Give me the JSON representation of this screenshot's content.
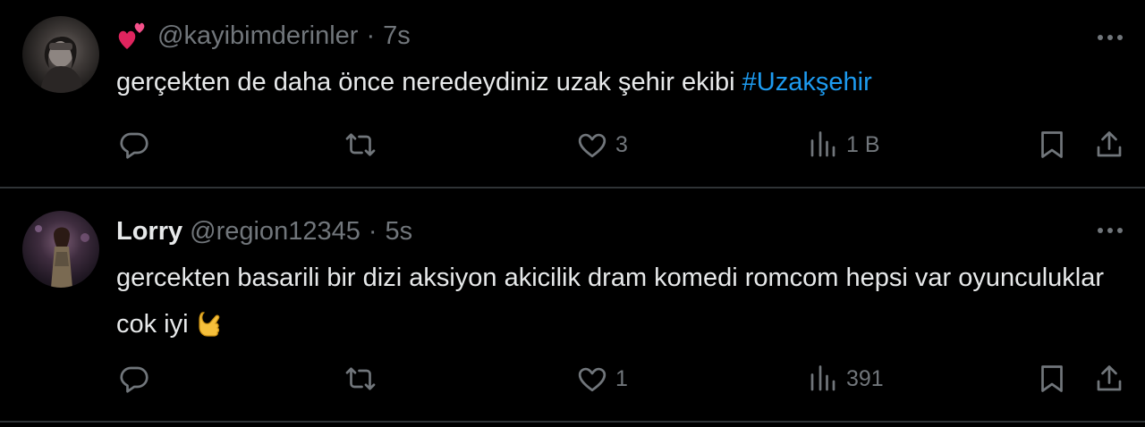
{
  "tweets": [
    {
      "display_name": "",
      "badge_icon": "two-hearts-icon",
      "handle": "@kayibimderinler",
      "separator": "·",
      "time": "7s",
      "text": "gerçekten de daha önce neredeydiniz uzak şehir ekibi ",
      "hashtag": "#Uzakşehir",
      "likes": "3",
      "views": "1 B"
    },
    {
      "display_name": "Lorry",
      "handle": "@region12345",
      "separator": "·",
      "time": "5s",
      "text": "gercekten basarili bir dizi aksiyon akicilik dram komedi romcom hepsi var oyunculuklar cok iyi",
      "trailing_emoji": "ok-hand-icon",
      "likes": "1",
      "views": "391"
    }
  ],
  "colors": {
    "background": "#000000",
    "text": "#e7e9ea",
    "muted": "#71767b",
    "hashtag": "#1d9bf0",
    "divider": "#2f3336"
  }
}
